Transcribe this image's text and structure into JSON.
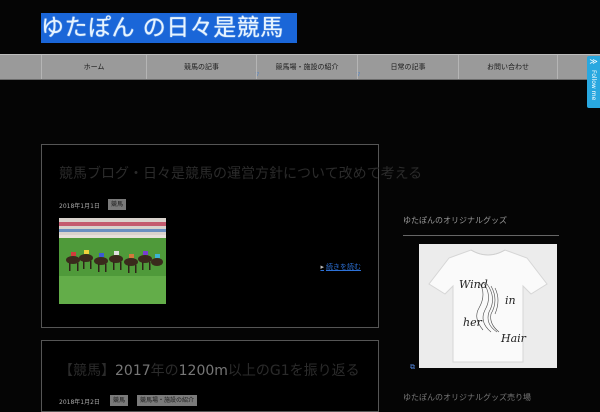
{
  "site": {
    "title": "ゆたぽん の日々是競馬"
  },
  "nav": {
    "items": [
      {
        "label": "ホーム",
        "has_dropdown": false
      },
      {
        "label": "競馬の記事",
        "has_dropdown": true
      },
      {
        "label": "競馬場・施設の紹介",
        "has_dropdown": true
      },
      {
        "label": "日常の記事",
        "has_dropdown": false
      },
      {
        "label": "お問い合わせ",
        "has_dropdown": false
      }
    ]
  },
  "follow": {
    "label": "Follow me",
    "color": "#29a8e0"
  },
  "posts": [
    {
      "title": "競馬ブログ・日々是競馬の運営方針について改めて考える",
      "date": "2018年1月1日",
      "tags": [
        "競馬"
      ],
      "more_label": "続きを読む",
      "thumbnail": "horse-race-photo"
    },
    {
      "title": "2017年の1200m以上のG1を振り返る",
      "title_lead": "【競馬】",
      "title_mid": "2017",
      "title_rest": "年の",
      "title_num": "1200m",
      "title_tail": "以上のG1を振り返る",
      "date": "2018年1月2日",
      "tags": [
        "競馬",
        "競馬場・施設の紹介"
      ]
    }
  ],
  "sidebar": {
    "widget_title": "ゆたぽんのオリジナルグッズ",
    "shirt_text": [
      "Wind",
      "in",
      "her",
      "Hair"
    ],
    "widget2_title": "ゆたぽんのオリジナルグッズ売り場"
  },
  "colors": {
    "accent": "#2d72d9",
    "nav_bg": "#9a9a9a",
    "logo_bg": "#1a66d8"
  }
}
